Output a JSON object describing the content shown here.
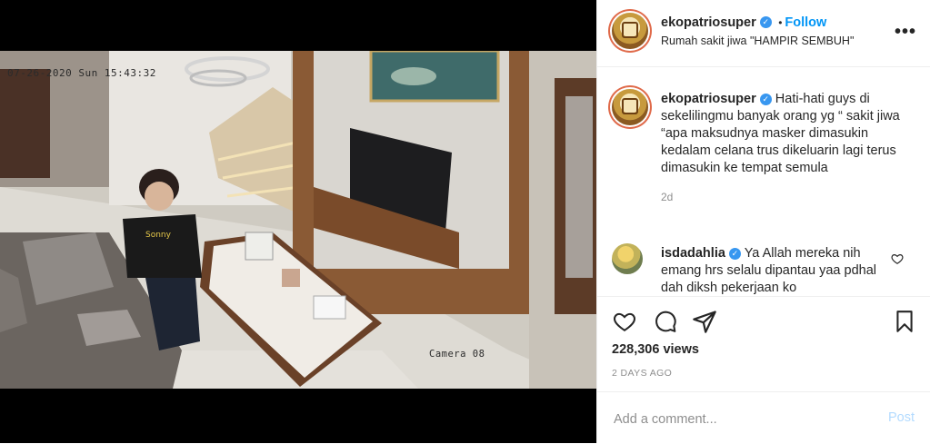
{
  "post": {
    "username": "ekopatriosuper",
    "follow_separator": "•",
    "follow_label": "Follow",
    "location": "Rumah sakit jiwa \"HAMPIR SEMBUH\"",
    "more_icon": "more-options-icon"
  },
  "media": {
    "timestamp_overlay": "07-26-2020 Sun 15:43:32",
    "camera_label": "Camera 08",
    "shirt_text": "Sonny"
  },
  "caption": {
    "username": "ekopatriosuper",
    "text": "Hati-hati guys di sekelilingmu banyak orang yg “ sakit jiwa “apa maksudnya masker dimasukin kedalam celana trus dikeluarin lagi terus dimasukin ke tempat semula",
    "age": "2d"
  },
  "comments": [
    {
      "username": "isdadahlia",
      "text": "Ya Allah mereka nih emang hrs selalu dipantau yaa pdhal dah diksh pekerjaan ko"
    }
  ],
  "actions": {
    "like_icon": "heart-icon",
    "comment_icon": "comment-icon",
    "share_icon": "share-icon",
    "save_icon": "bookmark-icon"
  },
  "stats": {
    "views": "228,306 views",
    "date": "2 DAYS AGO"
  },
  "add_comment": {
    "placeholder": "Add a comment...",
    "post_label": "Post"
  },
  "colors": {
    "accent": "#0095f6",
    "verified": "#3897f0",
    "post_disabled": "#b3dbff",
    "muted": "#8e8e8e"
  }
}
